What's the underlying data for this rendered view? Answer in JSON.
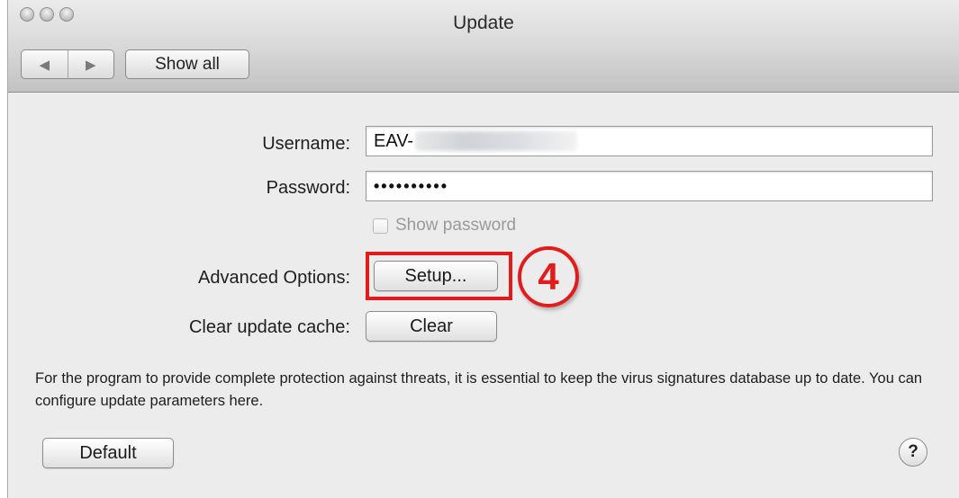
{
  "window": {
    "title": "Update",
    "nav": {
      "back_glyph": "◀",
      "forward_glyph": "▶"
    },
    "show_all_label": "Show all"
  },
  "form": {
    "username_label": "Username:",
    "username_value": "EAV-",
    "password_label": "Password:",
    "password_value": "••••••••••",
    "show_password_label": "Show password",
    "show_password_checked": false,
    "advanced_label": "Advanced Options:",
    "setup_button": "Setup...",
    "clear_cache_label": "Clear update cache:",
    "clear_button": "Clear"
  },
  "annotation": {
    "step_number": "4",
    "color": "#e21b1b"
  },
  "description": "For the program to provide complete protection against threats, it is essential to keep the virus signatures database up to date. You can configure update parameters here.",
  "footer": {
    "default_button": "Default",
    "help_glyph": "?"
  }
}
